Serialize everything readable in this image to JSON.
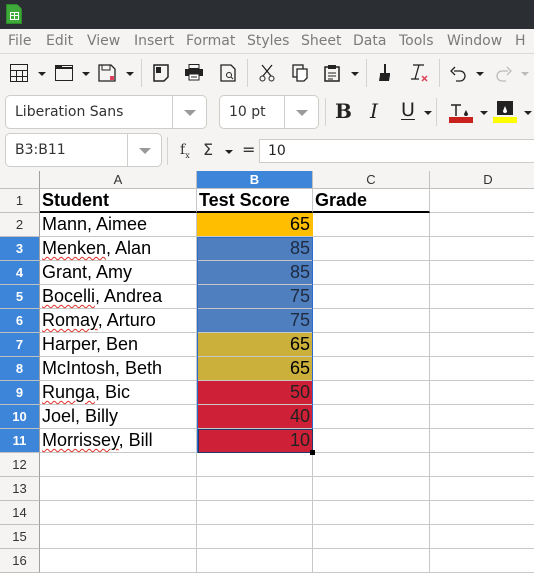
{
  "window": {
    "app_icon": "libreoffice-calc-icon"
  },
  "menu": [
    "File",
    "Edit",
    "View",
    "Insert",
    "Format",
    "Styles",
    "Sheet",
    "Data",
    "Tools",
    "Window",
    "H"
  ],
  "toolbar": {
    "standard": [
      "insert-table-icon",
      "open-icon",
      "save-icon",
      "export-pdf-icon",
      "print-icon",
      "print-preview-icon",
      "cut-icon",
      "copy-icon",
      "paste-icon",
      "clone-formatting-icon",
      "clear-formatting-icon",
      "undo-icon",
      "redo-icon"
    ],
    "font_name": "Liberation Sans",
    "font_size": "10 pt",
    "bold_label": "B",
    "italic_label": "I",
    "underline_label": "U",
    "font_color": "#c9211e",
    "highlight_color": "#ffff00"
  },
  "formula_bar": {
    "name_box": "B3:B11",
    "fx_label": "fx",
    "sum_label": "Σ",
    "equals_label": "=",
    "content": "10"
  },
  "sheet": {
    "columns": [
      "A",
      "B",
      "C",
      "D"
    ],
    "selected_column": "B",
    "selection": "B3:B11",
    "rows": [
      {
        "num": "1",
        "selected": false,
        "cells": [
          "Student",
          "Test Score",
          "Grade",
          ""
        ],
        "fill": ""
      },
      {
        "num": "2",
        "selected": false,
        "cells": [
          "Mann, Aimee",
          "65",
          "",
          ""
        ],
        "fill": "#ffbf00"
      },
      {
        "num": "3",
        "selected": true,
        "cells": [
          "Menken, Alan",
          "85",
          "",
          ""
        ],
        "fill": "#4f7fbe"
      },
      {
        "num": "4",
        "selected": true,
        "cells": [
          "Grant, Amy",
          "85",
          "",
          ""
        ],
        "fill": "#4f7fbe"
      },
      {
        "num": "5",
        "selected": true,
        "cells": [
          "Bocelli, Andrea",
          "75",
          "",
          ""
        ],
        "fill": "#4f7fbe"
      },
      {
        "num": "6",
        "selected": true,
        "cells": [
          "Romay, Arturo",
          "75",
          "",
          ""
        ],
        "fill": "#4f7fbe"
      },
      {
        "num": "7",
        "selected": true,
        "cells": [
          "Harper, Ben",
          "65",
          "",
          ""
        ],
        "fill": "#ccb03c"
      },
      {
        "num": "8",
        "selected": true,
        "cells": [
          "McIntosh, Beth",
          "65",
          "",
          ""
        ],
        "fill": "#ccb03c"
      },
      {
        "num": "9",
        "selected": true,
        "cells": [
          "Runga, Bic",
          "50",
          "",
          ""
        ],
        "fill": "#ce2138"
      },
      {
        "num": "10",
        "selected": true,
        "cells": [
          "Joel, Billy",
          "40",
          "",
          ""
        ],
        "fill": "#ce2138"
      },
      {
        "num": "11",
        "selected": true,
        "cells": [
          "Morrissey, Bill",
          "10",
          "",
          ""
        ],
        "fill": "#ce2138"
      },
      {
        "num": "12",
        "selected": false,
        "cells": [
          "",
          "",
          "",
          ""
        ],
        "fill": ""
      },
      {
        "num": "13",
        "selected": false,
        "cells": [
          "",
          "",
          "",
          ""
        ],
        "fill": ""
      },
      {
        "num": "14",
        "selected": false,
        "cells": [
          "",
          "",
          "",
          ""
        ],
        "fill": ""
      },
      {
        "num": "15",
        "selected": false,
        "cells": [
          "",
          "",
          "",
          ""
        ],
        "fill": ""
      },
      {
        "num": "16",
        "selected": false,
        "cells": [
          "",
          "",
          "",
          ""
        ],
        "fill": ""
      }
    ],
    "spellcheck_flagged": [
      "Menken",
      "Bocelli",
      "Romay",
      "Runga",
      "Morrissey"
    ]
  }
}
